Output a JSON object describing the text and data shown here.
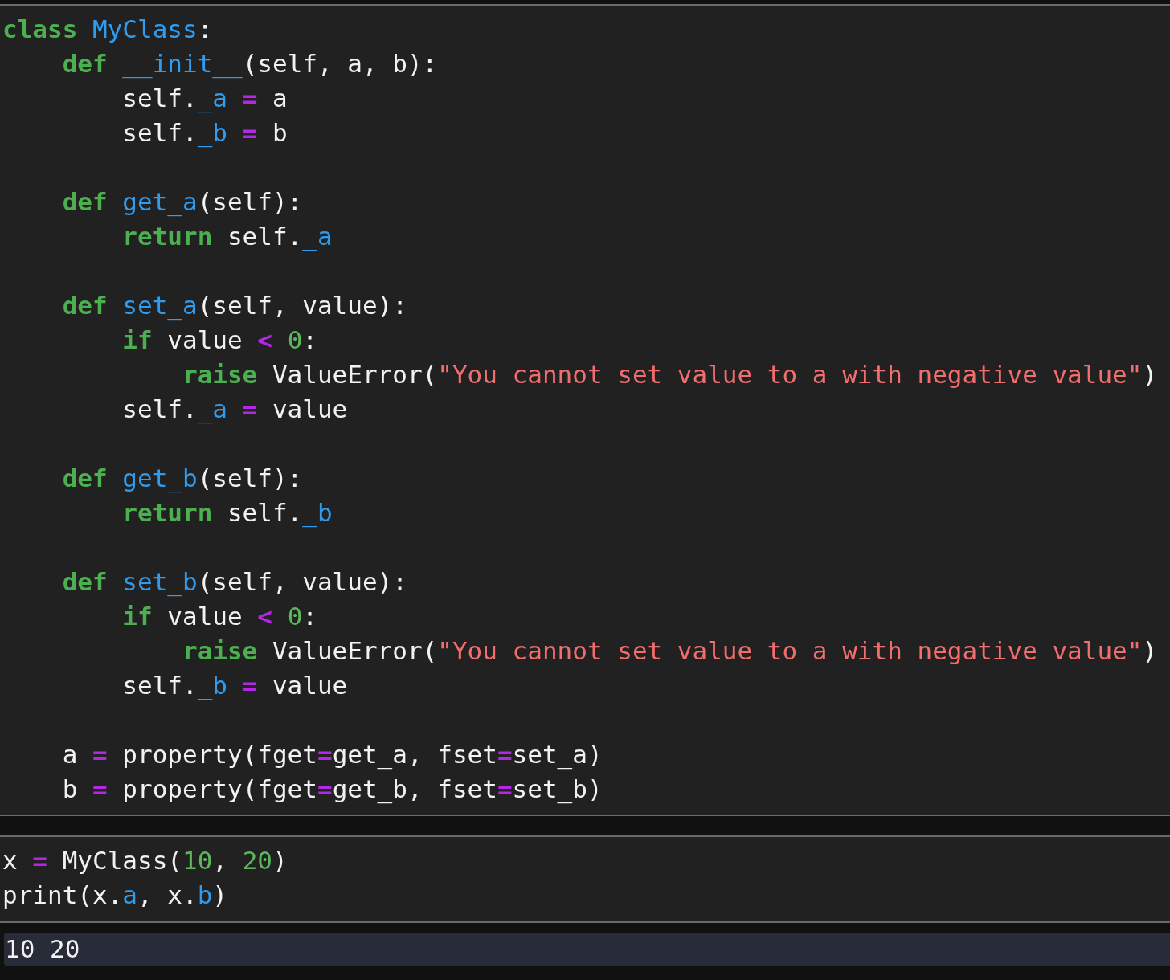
{
  "cells": [
    {
      "kind": "code",
      "lines": [
        {
          "kind": "code",
          "tokens": [
            {
              "text": "class",
              "kind": "keyword"
            },
            {
              "text": " MyClass",
              "kind": "name"
            },
            {
              "text": ":",
              "kind": "plain"
            }
          ]
        },
        {
          "kind": "code",
          "tokens": [
            {
              "text": "    def",
              "kind": "keyword"
            },
            {
              "text": " __init__",
              "kind": "name"
            },
            {
              "text": "(self, a, b):",
              "kind": "plain"
            }
          ]
        },
        {
          "kind": "code",
          "tokens": [
            {
              "text": "        self.",
              "kind": "plain"
            },
            {
              "text": "_a",
              "kind": "name"
            },
            {
              "text": " =",
              "kind": "operator"
            },
            {
              "text": " a",
              "kind": "plain"
            }
          ]
        },
        {
          "kind": "code",
          "tokens": [
            {
              "text": "        self.",
              "kind": "plain"
            },
            {
              "text": "_b",
              "kind": "name"
            },
            {
              "text": " =",
              "kind": "operator"
            },
            {
              "text": " b",
              "kind": "plain"
            }
          ]
        },
        {
          "kind": "blank"
        },
        {
          "kind": "code",
          "tokens": [
            {
              "text": "    def",
              "kind": "keyword"
            },
            {
              "text": " get_a",
              "kind": "name"
            },
            {
              "text": "(self):",
              "kind": "plain"
            }
          ]
        },
        {
          "kind": "code",
          "tokens": [
            {
              "text": "        return",
              "kind": "keyword"
            },
            {
              "text": " self.",
              "kind": "plain"
            },
            {
              "text": "_a",
              "kind": "name"
            }
          ]
        },
        {
          "kind": "blank"
        },
        {
          "kind": "code",
          "tokens": [
            {
              "text": "    def",
              "kind": "keyword"
            },
            {
              "text": " set_a",
              "kind": "name"
            },
            {
              "text": "(self, value):",
              "kind": "plain"
            }
          ]
        },
        {
          "kind": "code",
          "tokens": [
            {
              "text": "        if",
              "kind": "keyword"
            },
            {
              "text": " value ",
              "kind": "plain"
            },
            {
              "text": "<",
              "kind": "operator"
            },
            {
              "text": " 0",
              "kind": "number"
            },
            {
              "text": ":",
              "kind": "plain"
            }
          ]
        },
        {
          "kind": "code",
          "tokens": [
            {
              "text": "            raise",
              "kind": "keyword"
            },
            {
              "text": " ValueError(",
              "kind": "plain"
            },
            {
              "text": "\"You cannot set value to a with negative value\"",
              "kind": "string"
            },
            {
              "text": ")",
              "kind": "plain"
            }
          ]
        },
        {
          "kind": "code",
          "tokens": [
            {
              "text": "        self.",
              "kind": "plain"
            },
            {
              "text": "_a",
              "kind": "name"
            },
            {
              "text": " =",
              "kind": "operator"
            },
            {
              "text": " value",
              "kind": "plain"
            }
          ]
        },
        {
          "kind": "blank"
        },
        {
          "kind": "code",
          "tokens": [
            {
              "text": "    def",
              "kind": "keyword"
            },
            {
              "text": " get_b",
              "kind": "name"
            },
            {
              "text": "(self):",
              "kind": "plain"
            }
          ]
        },
        {
          "kind": "code",
          "tokens": [
            {
              "text": "        return",
              "kind": "keyword"
            },
            {
              "text": " self.",
              "kind": "plain"
            },
            {
              "text": "_b",
              "kind": "name"
            }
          ]
        },
        {
          "kind": "blank"
        },
        {
          "kind": "code",
          "tokens": [
            {
              "text": "    def",
              "kind": "keyword"
            },
            {
              "text": " set_b",
              "kind": "name"
            },
            {
              "text": "(self, value):",
              "kind": "plain"
            }
          ]
        },
        {
          "kind": "code",
          "tokens": [
            {
              "text": "        if",
              "kind": "keyword"
            },
            {
              "text": " value ",
              "kind": "plain"
            },
            {
              "text": "<",
              "kind": "operator"
            },
            {
              "text": " 0",
              "kind": "number"
            },
            {
              "text": ":",
              "kind": "plain"
            }
          ]
        },
        {
          "kind": "code",
          "tokens": [
            {
              "text": "            raise",
              "kind": "keyword"
            },
            {
              "text": " ValueError(",
              "kind": "plain"
            },
            {
              "text": "\"You cannot set value to a with negative value\"",
              "kind": "string"
            },
            {
              "text": ")",
              "kind": "plain"
            }
          ]
        },
        {
          "kind": "code",
          "tokens": [
            {
              "text": "        self.",
              "kind": "plain"
            },
            {
              "text": "_b",
              "kind": "name"
            },
            {
              "text": " =",
              "kind": "operator"
            },
            {
              "text": " value",
              "kind": "plain"
            }
          ]
        },
        {
          "kind": "blank"
        },
        {
          "kind": "code",
          "tokens": [
            {
              "text": "    a ",
              "kind": "plain"
            },
            {
              "text": "=",
              "kind": "operator"
            },
            {
              "text": " property(fget",
              "kind": "plain"
            },
            {
              "text": "=",
              "kind": "operator"
            },
            {
              "text": "get_a, fset",
              "kind": "plain"
            },
            {
              "text": "=",
              "kind": "operator"
            },
            {
              "text": "set_a)",
              "kind": "plain"
            }
          ]
        },
        {
          "kind": "code",
          "tokens": [
            {
              "text": "    b ",
              "kind": "plain"
            },
            {
              "text": "=",
              "kind": "operator"
            },
            {
              "text": " property(fget",
              "kind": "plain"
            },
            {
              "text": "=",
              "kind": "operator"
            },
            {
              "text": "get_b, fset",
              "kind": "plain"
            },
            {
              "text": "=",
              "kind": "operator"
            },
            {
              "text": "set_b)",
              "kind": "plain"
            }
          ]
        }
      ]
    },
    {
      "kind": "code",
      "lines": [
        {
          "kind": "code",
          "tokens": [
            {
              "text": "x ",
              "kind": "plain"
            },
            {
              "text": "=",
              "kind": "operator"
            },
            {
              "text": " MyClass(",
              "kind": "plain"
            },
            {
              "text": "10",
              "kind": "number"
            },
            {
              "text": ", ",
              "kind": "plain"
            },
            {
              "text": "20",
              "kind": "number"
            },
            {
              "text": ")",
              "kind": "plain"
            }
          ]
        },
        {
          "kind": "code",
          "tokens": [
            {
              "text": "print(x.",
              "kind": "plain"
            },
            {
              "text": "a",
              "kind": "name"
            },
            {
              "text": ", x.",
              "kind": "plain"
            },
            {
              "text": "b",
              "kind": "name"
            },
            {
              "text": ")",
              "kind": "plain"
            }
          ]
        }
      ]
    },
    {
      "kind": "output",
      "text": "10 20"
    }
  ]
}
